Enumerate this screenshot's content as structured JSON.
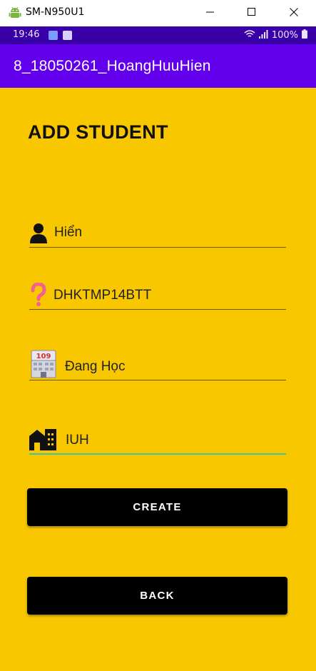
{
  "window": {
    "title": "SM-N950U1",
    "icons": [
      "android-icon",
      "minimize-icon",
      "maximize-icon",
      "close-icon"
    ]
  },
  "status_bar": {
    "time": "19:46",
    "battery": "100%",
    "icons": [
      "notification-icon",
      "wifi-icon",
      "signal-icon",
      "battery-icon"
    ]
  },
  "app_bar": {
    "title": "8_18050261_HoangHuuHien"
  },
  "form": {
    "heading": "ADD STUDENT",
    "fields": [
      {
        "icon": "person-icon",
        "value": "Hiển"
      },
      {
        "icon": "question-icon",
        "value": "DHKTMP14BTT"
      },
      {
        "icon": "school-icon",
        "value": "Đang Học"
      },
      {
        "icon": "building-icon",
        "value": "IUH"
      }
    ],
    "create_label": "CREATE",
    "back_label": "BACK"
  },
  "colors": {
    "status_bar": "#3a00a8",
    "app_bar": "#6200ee",
    "background": "#f8c700",
    "button": "#000000",
    "focus_line": "#37c6a8"
  }
}
